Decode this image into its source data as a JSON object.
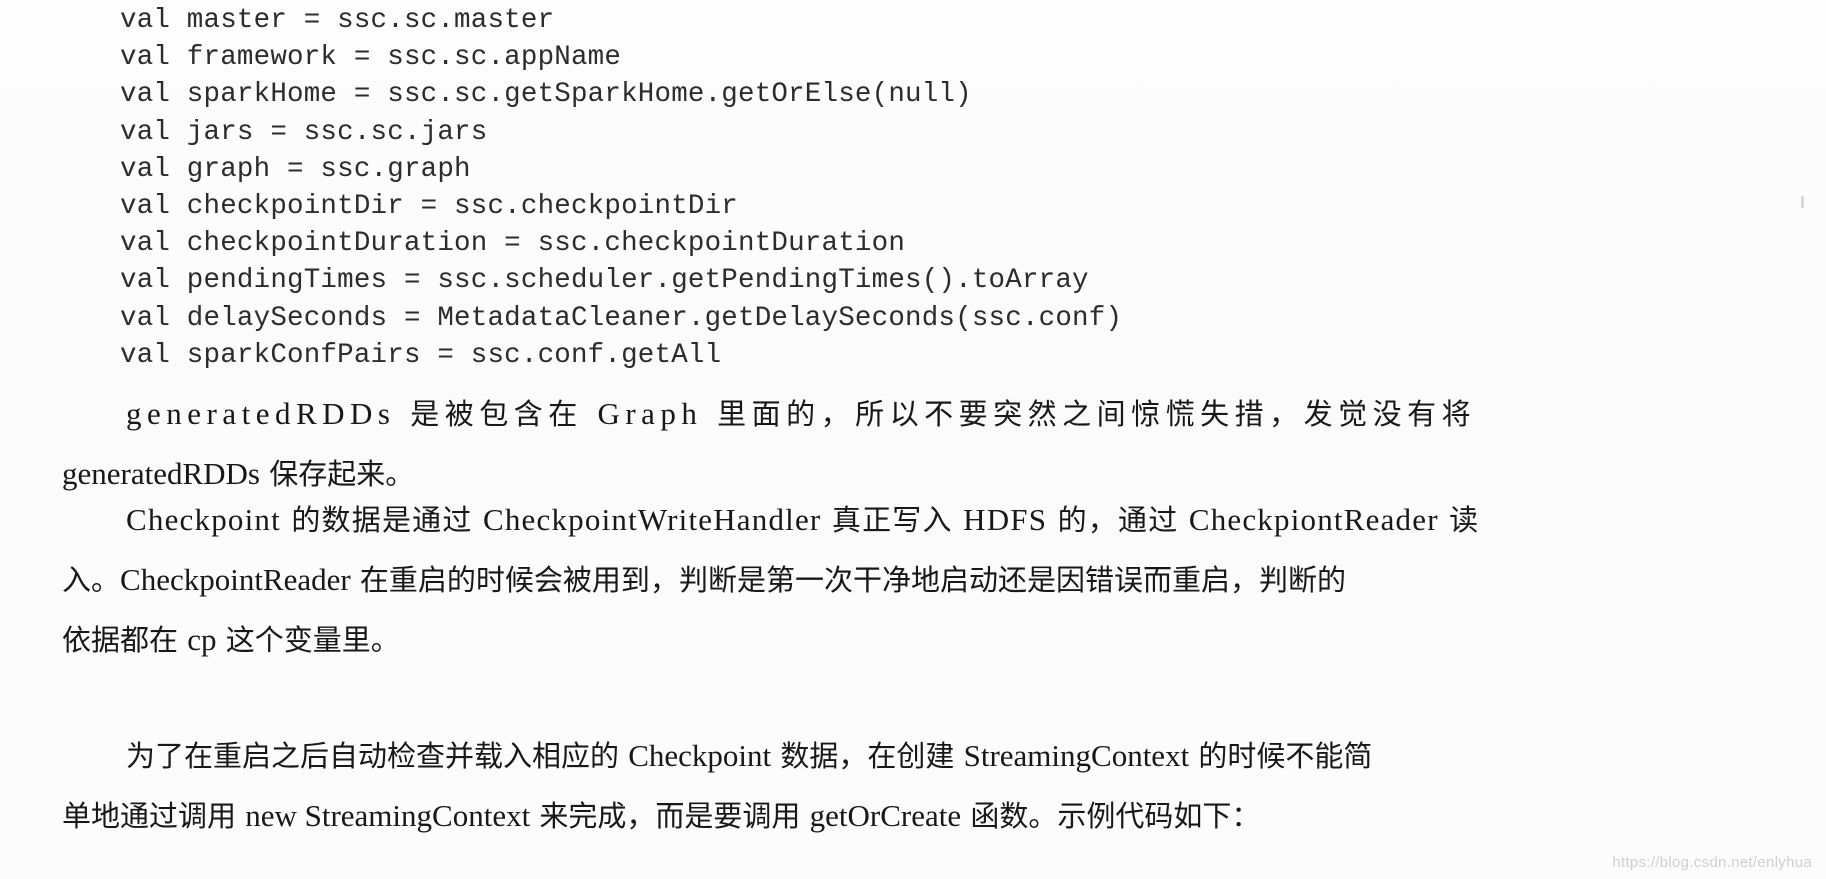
{
  "page": {
    "kind": "scanned-book-page",
    "language": "zh-CN",
    "background_color": "#ffffff",
    "text_color": "#181818"
  },
  "code_block": {
    "language": "scala",
    "lines": [
      "val master = ssc.sc.master",
      "val framework = ssc.sc.appName",
      "val sparkHome = ssc.sc.getSparkHome.getOrElse(null)",
      "val jars = ssc.sc.jars",
      "val graph = ssc.graph",
      "val checkpointDir = ssc.checkpointDir",
      "val checkpointDuration = ssc.checkpointDuration",
      "val pendingTimes = ssc.scheduler.getPendingTimes().toArray",
      "val delaySeconds = MetadataCleaner.getDelaySeconds(ssc.conf)",
      "val sparkConfPairs = ssc.conf.getAll"
    ]
  },
  "paragraphs": [
    {
      "id": "para-generated",
      "lines": [
        "generatedRDDs 是被包含在 Graph 里面的，所以不要突然之间惊慌失措，发觉没有将",
        "generatedRDDs 保存起来。"
      ],
      "segments": [
        [
          {
            "text": "generatedRDDs",
            "script": "latin"
          },
          {
            "text": " 是被包含在 ",
            "script": "cjk"
          },
          {
            "text": "Graph",
            "script": "latin"
          },
          {
            "text": " 里面的，所以不要突然之间惊慌失措，发觉没有将",
            "script": "cjk"
          }
        ],
        [
          {
            "text": "generatedRDDs",
            "script": "latin"
          },
          {
            "text": " 保存起来。",
            "script": "cjk"
          }
        ]
      ]
    },
    {
      "id": "para-checkpoint",
      "lines": [
        "Checkpoint 的数据是通过 CheckpointWriteHandler 真正写入 HDFS 的，通过 CheckpiontReader 读",
        "入。CheckpointReader 在重启的时候会被用到，判断是第一次干净地启动还是因错误而重启，判断的",
        "依据都在 cp 这个变量里。"
      ],
      "segments": [
        [
          {
            "text": "Checkpoint",
            "script": "latin"
          },
          {
            "text": " 的数据是通过 ",
            "script": "cjk"
          },
          {
            "text": "CheckpointWriteHandler",
            "script": "latin"
          },
          {
            "text": " 真正写入 ",
            "script": "cjk"
          },
          {
            "text": "HDFS",
            "script": "latin"
          },
          {
            "text": " 的，通过 ",
            "script": "cjk"
          },
          {
            "text": "CheckpiontReader",
            "script": "latin"
          },
          {
            "text": " 读",
            "script": "cjk"
          }
        ],
        [
          {
            "text": "入。",
            "script": "cjk"
          },
          {
            "text": "CheckpointReader",
            "script": "latin"
          },
          {
            "text": " 在重启的时候会被用到，判断是第一次干净地启动还是因错误而重启，判断的",
            "script": "cjk"
          }
        ],
        [
          {
            "text": "依据都在 ",
            "script": "cjk"
          },
          {
            "text": "cp",
            "script": "latin"
          },
          {
            "text": " 这个变量里。",
            "script": "cjk"
          }
        ]
      ]
    },
    {
      "id": "para-getorcreate",
      "lines": [
        "为了在重启之后自动检查并载入相应的 Checkpoint 数据，在创建 StreamingContext 的时候不能简",
        "单地通过调用 new StreamingContext 来完成，而是要调用 getOrCreate 函数。示例代码如下："
      ],
      "segments": [
        [
          {
            "text": "为了在重启之后自动检查并载入相应的 ",
            "script": "cjk"
          },
          {
            "text": "Checkpoint",
            "script": "latin"
          },
          {
            "text": " 数据，在创建 ",
            "script": "cjk"
          },
          {
            "text": "StreamingContext",
            "script": "latin"
          },
          {
            "text": " 的时候不能简",
            "script": "cjk"
          }
        ],
        [
          {
            "text": "单地通过调用 ",
            "script": "cjk"
          },
          {
            "text": "new StreamingContext",
            "script": "latin"
          },
          {
            "text": " 来完成，而是要调用 ",
            "script": "cjk"
          },
          {
            "text": "getOrCreate",
            "script": "latin"
          },
          {
            "text": " 函数。示例代码如下：",
            "script": "cjk"
          }
        ]
      ]
    }
  ],
  "watermark": {
    "text": "https://blog.csdn.net/enlyhua",
    "color": "#cfcfcf"
  }
}
